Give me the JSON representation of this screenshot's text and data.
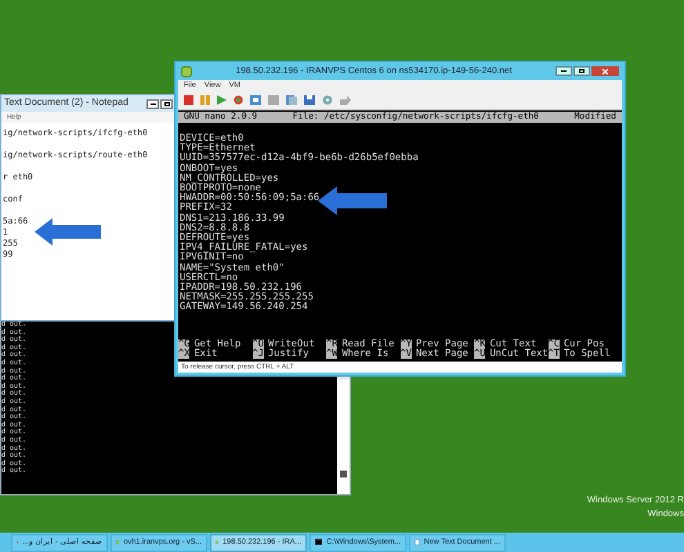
{
  "notepad": {
    "title": "Text Document (2) - Notepad",
    "menu": [
      "Help"
    ],
    "blocks": [
      [
        "ig/network-scripts/ifcfg-eth0"
      ],
      [
        "ig/network-scripts/route-eth0"
      ],
      [
        "r eth0"
      ],
      [
        "conf"
      ],
      [
        "5a:66",
        "1",
        "255",
        "99"
      ]
    ]
  },
  "console": {
    "lines": [
      "d out.",
      "d out.",
      "d out.",
      "d out.",
      "d out.",
      "d out.",
      "d out.",
      "d out.",
      "d out.",
      "d out.",
      "d out.",
      "d out.",
      "d out.",
      "d out.",
      "d out.",
      "d out.",
      "d out.",
      "d out.",
      "d out.",
      "d out."
    ]
  },
  "vm_window": {
    "title": "198.50.232.196 - IRANVPS Centos 6 on ns534170.ip-149-56-240.net",
    "menu": [
      "File",
      "View",
      "VM"
    ],
    "nano": {
      "version": "GNU nano 2.0.9",
      "file": "File: /etc/sysconfig/network-scripts/ifcfg-eth0",
      "state": "Modified",
      "lines": [
        "DEVICE=eth0",
        "TYPE=Ethernet",
        "UUID=357577ec-d12a-4bf9-be6b-d26b5ef0ebba",
        "ONBOOT=yes",
        "NM_CONTROLLED=yes",
        "BOOTPROTO=none",
        "HWADDR=00:50:56:09;5a:66",
        "PREFIX=32",
        "DNS1=213.186.33.99",
        "DNS2=8.8.8.8",
        "DEFROUTE=yes",
        "IPV4_FAILURE_FATAL=yes",
        "IPV6INIT=no",
        "NAME=\"System eth0\"",
        "USERCTL=no",
        "IPADDR=198.50.232.196",
        "NETMASK=255.255.255.255",
        "GATEWAY=149.56.240.254"
      ],
      "shortcuts": [
        {
          "key": "^G",
          "label": "Get Help"
        },
        {
          "key": "^O",
          "label": "WriteOut"
        },
        {
          "key": "^R",
          "label": "Read File"
        },
        {
          "key": "^Y",
          "label": "Prev Page"
        },
        {
          "key": "^K",
          "label": "Cut Text"
        },
        {
          "key": "^C",
          "label": "Cur Pos"
        },
        {
          "key": "^X",
          "label": "Exit"
        },
        {
          "key": "^J",
          "label": "Justify"
        },
        {
          "key": "^W",
          "label": "Where Is"
        },
        {
          "key": "^V",
          "label": "Next Page"
        },
        {
          "key": "^U",
          "label": "UnCut Text"
        },
        {
          "key": "^T",
          "label": "To Spell"
        }
      ]
    },
    "status_text": "To release cursor, press CTRL + ALT"
  },
  "desktop": {
    "edition_lines": [
      "Windows Server 2012 R",
      "Windows"
    ]
  },
  "taskbar": {
    "items": [
      {
        "kind": "browser",
        "label": "صفحه اصلی - ایران و...",
        "selected": false
      },
      {
        "kind": "vm",
        "label": "ovh1.iranvps.org - vS...",
        "selected": false
      },
      {
        "kind": "vm",
        "label": "198.50.232.196 - IRA...",
        "selected": true
      },
      {
        "kind": "console",
        "label": "C:\\Windows\\System...",
        "selected": false
      },
      {
        "kind": "notepad",
        "label": "New Text Document ...",
        "selected": false
      }
    ]
  }
}
